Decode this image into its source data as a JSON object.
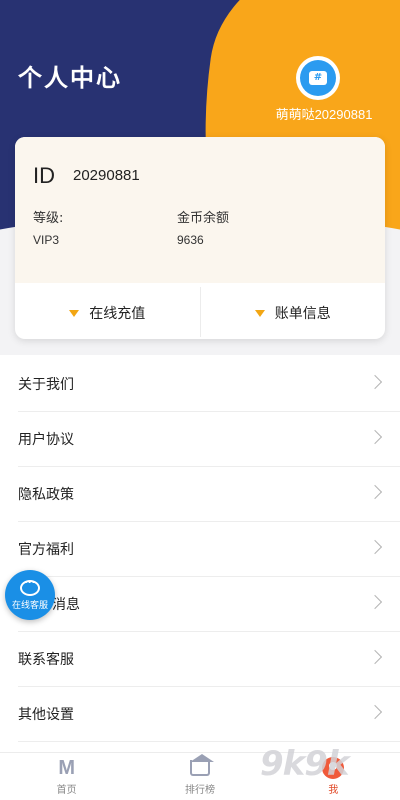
{
  "header": {
    "title": "个人中心",
    "username": "萌萌哒20290881",
    "avatar_icon": "note-icon"
  },
  "colors": {
    "header_bg": "#283272",
    "accent_orange": "#f9a61a",
    "service_blue": "#1a8fe6",
    "active_tab": "#e14b2a"
  },
  "card": {
    "id_label": "ID",
    "id_value": "20290881",
    "level_label": "等级:",
    "level_value": "VIP3",
    "coins_label": "金币余额",
    "coins_value": "9636",
    "actions": [
      {
        "label": "在线充值",
        "icon": "triangle-down-icon"
      },
      {
        "label": "账单信息",
        "icon": "triangle-down-icon"
      }
    ]
  },
  "menu": {
    "items": [
      {
        "label": "关于我们"
      },
      {
        "label": "用户协议"
      },
      {
        "label": "隐私政策"
      },
      {
        "label": "官方福利"
      },
      {
        "label": "消息"
      },
      {
        "label": "联系客服"
      },
      {
        "label": "其他设置"
      }
    ]
  },
  "float_service": {
    "label": "在线客服",
    "icon": "chat-bubble-icon"
  },
  "tabbar": {
    "items": [
      {
        "label": "首页",
        "icon": "home-icon"
      },
      {
        "label": "排行榜",
        "icon": "crown-icon"
      },
      {
        "label": "我",
        "icon": "profile-icon",
        "active": true
      }
    ]
  },
  "watermark": {
    "text": "9k9k"
  }
}
